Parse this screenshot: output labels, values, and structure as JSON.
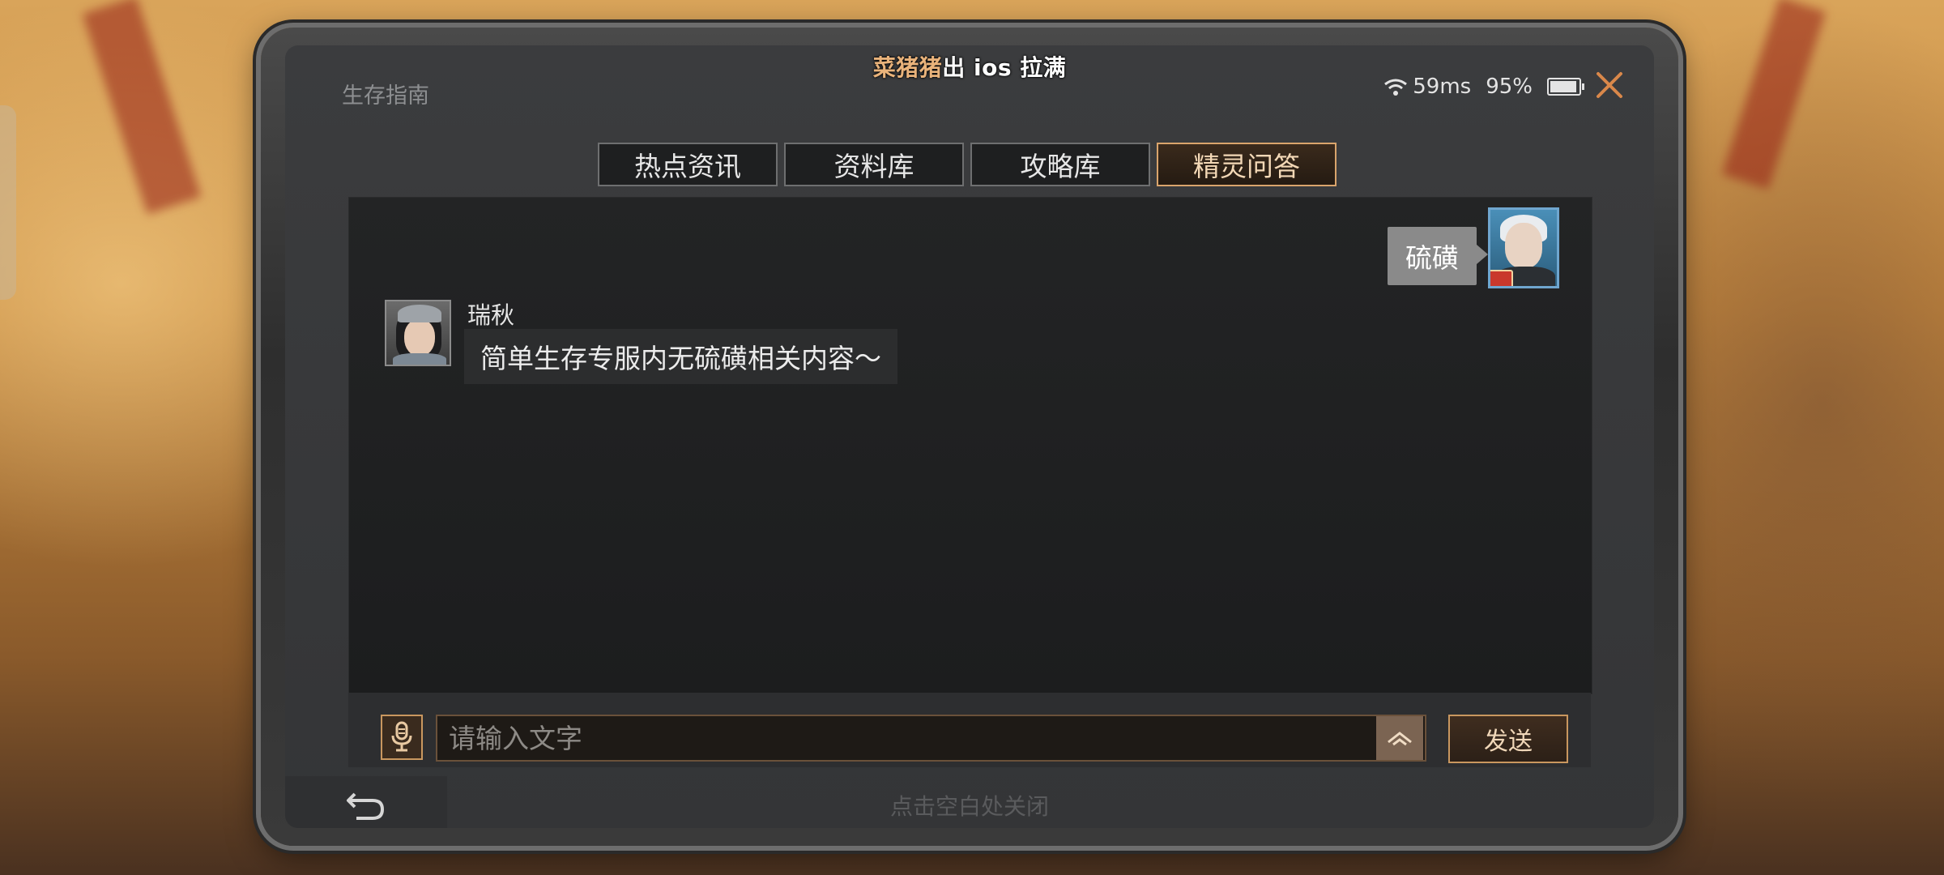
{
  "window": {
    "title": "生存指南"
  },
  "marquee": {
    "prefix": "菜猪猪",
    "text": "出 ios 拉满"
  },
  "status": {
    "ping": "59ms",
    "battery": "95%",
    "battery_level": 0.95
  },
  "tabs": [
    {
      "label": "热点资讯",
      "active": false
    },
    {
      "label": "资料库",
      "active": false
    },
    {
      "label": "攻略库",
      "active": false
    },
    {
      "label": "精灵问答",
      "active": true
    }
  ],
  "chat": {
    "user_message": "硫磺",
    "bot_name": "瑞秋",
    "bot_message": "简单生存专服内无硫磺相关内容～"
  },
  "input": {
    "placeholder": "请输入文字",
    "value": "",
    "send_label": "发送"
  },
  "footer": {
    "hint": "点击空白处关闭"
  },
  "colors": {
    "accent": "#d9a46c",
    "panel": "#1f2021",
    "frame": "#3a3a3a"
  }
}
